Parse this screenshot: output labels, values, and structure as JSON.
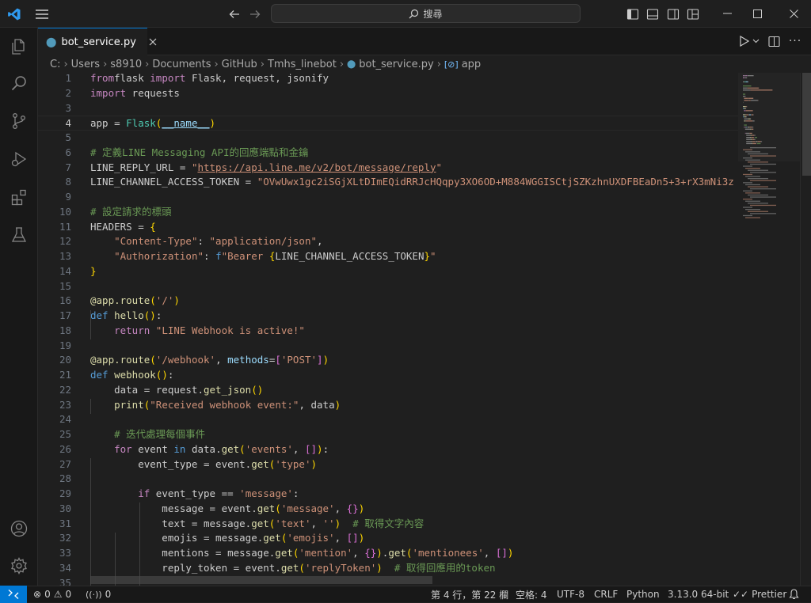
{
  "titlebar": {
    "search_placeholder": "搜尋"
  },
  "tab": {
    "filename": "bot_service.py",
    "icon": "python-icon"
  },
  "breadcrumb": [
    "C:",
    "Users",
    "s8910",
    "Documents",
    "GitHub",
    "Tmhs_linebot",
    "bot_service.py",
    "app"
  ],
  "status": {
    "errors": "0",
    "warnings": "0",
    "ports": "0",
    "position": "第 4 行，第 22 欄",
    "spaces": "空格: 4",
    "encoding": "UTF-8",
    "eol": "CRLF",
    "language": "Python",
    "interpreter": "3.13.0 64-bit",
    "formatter": "Prettier"
  },
  "colors": {
    "accent": "#0078d4",
    "background": "#1f1f1f",
    "keyword": "#c586c0",
    "string": "#ce9178",
    "comment": "#6a9955"
  },
  "current_line": 4,
  "code_lines": [
    {
      "n": "1",
      "t": [
        [
          "kw",
          "from"
        ],
        [
          "",
          "flask "
        ],
        [
          "kw",
          "import"
        ],
        [
          "",
          " Flask, request, jsonify"
        ]
      ]
    },
    {
      "n": "2",
      "t": [
        [
          "kw",
          "import"
        ],
        [
          "",
          " requests"
        ]
      ]
    },
    {
      "n": "3",
      "t": []
    },
    {
      "n": "4",
      "t": [
        [
          "",
          "app = "
        ],
        [
          "cl",
          "Flask"
        ],
        [
          "b1",
          "("
        ],
        [
          "vr ul",
          "__name__"
        ],
        [
          "b1",
          ")"
        ]
      ]
    },
    {
      "n": "5",
      "t": []
    },
    {
      "n": "6",
      "t": [
        [
          "cm",
          "# 定義LINE Messaging API的回應端點和金鑰"
        ]
      ]
    },
    {
      "n": "7",
      "t": [
        [
          "",
          "LINE_REPLY_URL = "
        ],
        [
          "st",
          "\""
        ],
        [
          "st ul",
          "https://api.line.me/v2/bot/message/reply"
        ],
        [
          "st",
          "\""
        ]
      ]
    },
    {
      "n": "8",
      "t": [
        [
          "",
          "LINE_CHANNEL_ACCESS_TOKEN = "
        ],
        [
          "st",
          "\"OVwUwx1gc2iSGjXLtDImEQidRRJcHQqpy3XO6OD+M884WGGISCtjSZKzhnUXDFBEaDn5+3+rX3mNi3z"
        ]
      ]
    },
    {
      "n": "9",
      "t": []
    },
    {
      "n": "10",
      "t": [
        [
          "cm",
          "# 設定請求的標頭"
        ]
      ]
    },
    {
      "n": "11",
      "t": [
        [
          "",
          "HEADERS = "
        ],
        [
          "b1",
          "{"
        ]
      ]
    },
    {
      "n": "12",
      "t": [
        [
          "",
          "    "
        ],
        [
          "st",
          "\"Content-Type\""
        ],
        [
          "pu",
          ": "
        ],
        [
          "st",
          "\"application/json\""
        ],
        [
          "pu",
          ","
        ]
      ]
    },
    {
      "n": "13",
      "t": [
        [
          "",
          "    "
        ],
        [
          "st",
          "\"Authorization\""
        ],
        [
          "pu",
          ": "
        ],
        [
          "kb",
          "f"
        ],
        [
          "st",
          "\"Bearer "
        ],
        [
          "b1",
          "{"
        ],
        [
          "",
          "LINE_CHANNEL_ACCESS_TOKEN"
        ],
        [
          "b1",
          "}"
        ],
        [
          "st",
          "\""
        ]
      ]
    },
    {
      "n": "14",
      "t": [
        [
          "b1",
          "}"
        ]
      ]
    },
    {
      "n": "15",
      "t": []
    },
    {
      "n": "16",
      "t": [
        [
          "fn",
          "@app.route"
        ],
        [
          "b1",
          "("
        ],
        [
          "st",
          "'/'"
        ],
        [
          "b1",
          ")"
        ]
      ]
    },
    {
      "n": "17",
      "t": [
        [
          "kb",
          "def"
        ],
        [
          "",
          " "
        ],
        [
          "fn",
          "hello"
        ],
        [
          "b1",
          "()"
        ],
        [
          "pu",
          ":"
        ]
      ]
    },
    {
      "n": "18",
      "t": [
        [
          "",
          "    "
        ],
        [
          "kw",
          "return"
        ],
        [
          "",
          " "
        ],
        [
          "st",
          "\"LINE Webhook is active!\""
        ]
      ]
    },
    {
      "n": "19",
      "t": []
    },
    {
      "n": "20",
      "t": [
        [
          "fn",
          "@app.route"
        ],
        [
          "b1",
          "("
        ],
        [
          "st",
          "'/webhook'"
        ],
        [
          "pu",
          ", "
        ],
        [
          "vr",
          "methods"
        ],
        [
          "pu",
          "="
        ],
        [
          "b2",
          "["
        ],
        [
          "st",
          "'POST'"
        ],
        [
          "b2",
          "]"
        ],
        [
          "b1",
          ")"
        ]
      ]
    },
    {
      "n": "21",
      "t": [
        [
          "kb",
          "def"
        ],
        [
          "",
          " "
        ],
        [
          "fn",
          "webhook"
        ],
        [
          "b1",
          "()"
        ],
        [
          "pu",
          ":"
        ]
      ]
    },
    {
      "n": "22",
      "t": [
        [
          "",
          "    data = request."
        ],
        [
          "fn",
          "get_json"
        ],
        [
          "b1",
          "()"
        ]
      ]
    },
    {
      "n": "23",
      "t": [
        [
          "",
          "    "
        ],
        [
          "fn",
          "print"
        ],
        [
          "b1",
          "("
        ],
        [
          "st",
          "\"Received webhook event:\""
        ],
        [
          "",
          ", data"
        ],
        [
          "b1",
          ")"
        ]
      ]
    },
    {
      "n": "24",
      "t": []
    },
    {
      "n": "25",
      "t": [
        [
          "",
          "    "
        ],
        [
          "cm",
          "# 迭代處理每個事件"
        ]
      ]
    },
    {
      "n": "26",
      "t": [
        [
          "",
          "    "
        ],
        [
          "kw",
          "for"
        ],
        [
          "",
          " event "
        ],
        [
          "kb",
          "in"
        ],
        [
          "",
          " data."
        ],
        [
          "fn",
          "get"
        ],
        [
          "b1",
          "("
        ],
        [
          "st",
          "'events'"
        ],
        [
          "",
          ", "
        ],
        [
          "b2",
          "[]"
        ],
        [
          "b1",
          ")"
        ],
        [
          "pu",
          ":"
        ]
      ]
    },
    {
      "n": "27",
      "t": [
        [
          "",
          "        event_type = event."
        ],
        [
          "fn",
          "get"
        ],
        [
          "b1",
          "("
        ],
        [
          "st",
          "'type'"
        ],
        [
          "b1",
          ")"
        ]
      ]
    },
    {
      "n": "28",
      "t": []
    },
    {
      "n": "29",
      "t": [
        [
          "",
          "        "
        ],
        [
          "kw",
          "if"
        ],
        [
          "",
          " event_type == "
        ],
        [
          "st",
          "'message'"
        ],
        [
          "pu",
          ":"
        ]
      ]
    },
    {
      "n": "30",
      "t": [
        [
          "",
          "            message = event."
        ],
        [
          "fn",
          "get"
        ],
        [
          "b1",
          "("
        ],
        [
          "st",
          "'message'"
        ],
        [
          "",
          ", "
        ],
        [
          "b2",
          "{}"
        ],
        [
          "b1",
          ")"
        ]
      ]
    },
    {
      "n": "31",
      "t": [
        [
          "",
          "            text = message."
        ],
        [
          "fn",
          "get"
        ],
        [
          "b1",
          "("
        ],
        [
          "st",
          "'text'"
        ],
        [
          "",
          ", "
        ],
        [
          "st",
          "''"
        ],
        [
          "b1",
          ")"
        ],
        [
          "",
          "  "
        ],
        [
          "cm",
          "# 取得文字內容"
        ]
      ]
    },
    {
      "n": "32",
      "t": [
        [
          "",
          "            emojis = message."
        ],
        [
          "fn",
          "get"
        ],
        [
          "b1",
          "("
        ],
        [
          "st",
          "'emojis'"
        ],
        [
          "",
          ", "
        ],
        [
          "b2",
          "[]"
        ],
        [
          "b1",
          ")"
        ]
      ]
    },
    {
      "n": "33",
      "t": [
        [
          "",
          "            mentions = message."
        ],
        [
          "fn",
          "get"
        ],
        [
          "b1",
          "("
        ],
        [
          "st",
          "'mention'"
        ],
        [
          "",
          ", "
        ],
        [
          "b2",
          "{}"
        ],
        [
          "b1",
          ")"
        ],
        [
          "",
          "."
        ],
        [
          "fn",
          "get"
        ],
        [
          "b1",
          "("
        ],
        [
          "st",
          "'mentionees'"
        ],
        [
          "",
          ", "
        ],
        [
          "b2",
          "[]"
        ],
        [
          "b1",
          ")"
        ]
      ]
    },
    {
      "n": "34",
      "t": [
        [
          "",
          "            reply_token = event."
        ],
        [
          "fn",
          "get"
        ],
        [
          "b1",
          "("
        ],
        [
          "st",
          "'replyToken'"
        ],
        [
          "b1",
          ")"
        ],
        [
          "",
          "  "
        ],
        [
          "cm",
          "# 取得回應用的token"
        ]
      ]
    },
    {
      "n": "35",
      "t": []
    }
  ]
}
